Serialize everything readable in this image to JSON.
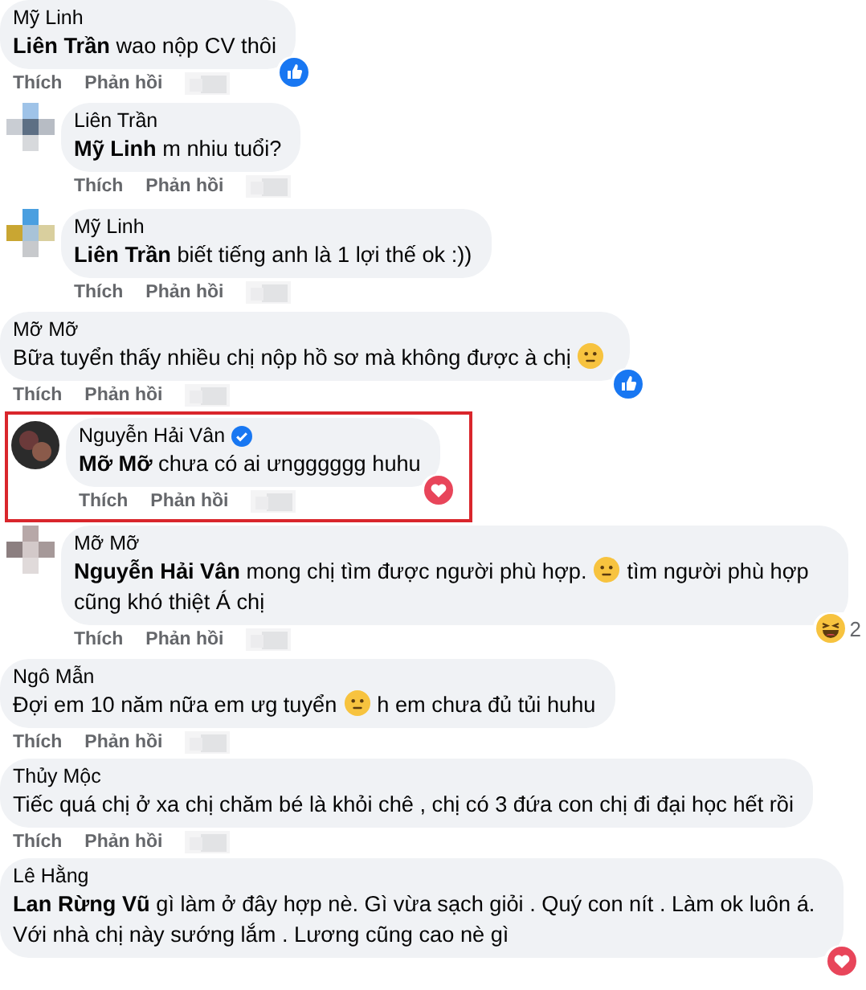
{
  "comments": [
    {
      "kind": "top",
      "highlighted": false,
      "author": "Mỹ Linh",
      "verified": false,
      "mention": "Liên Trần",
      "parts": [
        {
          "kind": "text",
          "text": "wao nộp CV thôi"
        }
      ],
      "reaction": {
        "kind": "like"
      },
      "actions": [
        "Thích",
        "Phản hồi"
      ]
    },
    {
      "kind": "reply",
      "highlighted": false,
      "author": "Liên Trần",
      "verified": false,
      "mention": "Mỹ Linh",
      "parts": [
        {
          "kind": "text",
          "text": "m nhiu tuổi?"
        }
      ],
      "actions": [
        "Thích",
        "Phản hồi"
      ]
    },
    {
      "kind": "reply",
      "highlighted": false,
      "author": "Mỹ Linh",
      "verified": false,
      "mention": "Liên Trần",
      "parts": [
        {
          "kind": "text",
          "text": "biết tiếng anh là 1 lợi thế ok :))"
        }
      ],
      "actions": [
        "Thích",
        "Phản hồi"
      ]
    },
    {
      "kind": "top",
      "highlighted": false,
      "author": "Mỡ Mỡ",
      "verified": false,
      "parts": [
        {
          "kind": "text",
          "text": "Bữa tuyển thấy nhiều chị nộp hồ sơ mà không được à chị"
        },
        {
          "kind": "emoji"
        }
      ],
      "reaction": {
        "kind": "like"
      },
      "actions": [
        "Thích",
        "Phản hồi"
      ]
    },
    {
      "kind": "reply",
      "highlighted": true,
      "author": "Nguyễn Hải Vân",
      "verified": true,
      "mention": "Mỡ Mỡ",
      "parts": [
        {
          "kind": "text",
          "text": "chưa có ai ưngggggg huhu"
        }
      ],
      "reaction": {
        "kind": "heart"
      },
      "actions": [
        "Thích",
        "Phản hồi"
      ]
    },
    {
      "kind": "reply",
      "highlighted": false,
      "author": "Mỡ Mỡ",
      "verified": false,
      "mention": "Nguyễn Hải Vân",
      "parts": [
        {
          "kind": "text",
          "text": "mong chị tìm được người phù hợp."
        },
        {
          "kind": "emoji"
        },
        {
          "kind": "text",
          "text": "tìm người phù hợp cũng khó thiệt Á chị"
        }
      ],
      "reaction": {
        "kind": "haha",
        "count": "2"
      },
      "actions": [
        "Thích",
        "Phản hồi"
      ]
    },
    {
      "kind": "top",
      "highlighted": false,
      "author": "Ngô Mẫn",
      "verified": false,
      "parts": [
        {
          "kind": "text",
          "text": "Đợi em 10 năm nữa em ưg tuyển"
        },
        {
          "kind": "emoji"
        },
        {
          "kind": "text",
          "text": "h em chưa đủ tủi huhu"
        }
      ],
      "actions": [
        "Thích",
        "Phản hồi"
      ]
    },
    {
      "kind": "top",
      "highlighted": false,
      "author": "Thủy Mộc",
      "verified": false,
      "parts": [
        {
          "kind": "text",
          "text": "Tiếc quá chị ở xa chị chăm bé là khỏi chê , chị có 3 đứa con chị đi đại học hết rồi"
        }
      ],
      "actions": [
        "Thích",
        "Phản hồi"
      ]
    },
    {
      "kind": "top",
      "highlighted": false,
      "author": "Lê Hằng",
      "verified": false,
      "mention": "Lan Rừng Vũ",
      "parts": [
        {
          "kind": "text",
          "text": "gì làm ở đây hợp nè. Gì vừa sạch giỏi . Quý con nít . Làm ok luôn á. Với nhà chị này sướng lắm . Lương cũng cao nè gì"
        }
      ],
      "reaction": {
        "kind": "heart"
      }
    }
  ]
}
